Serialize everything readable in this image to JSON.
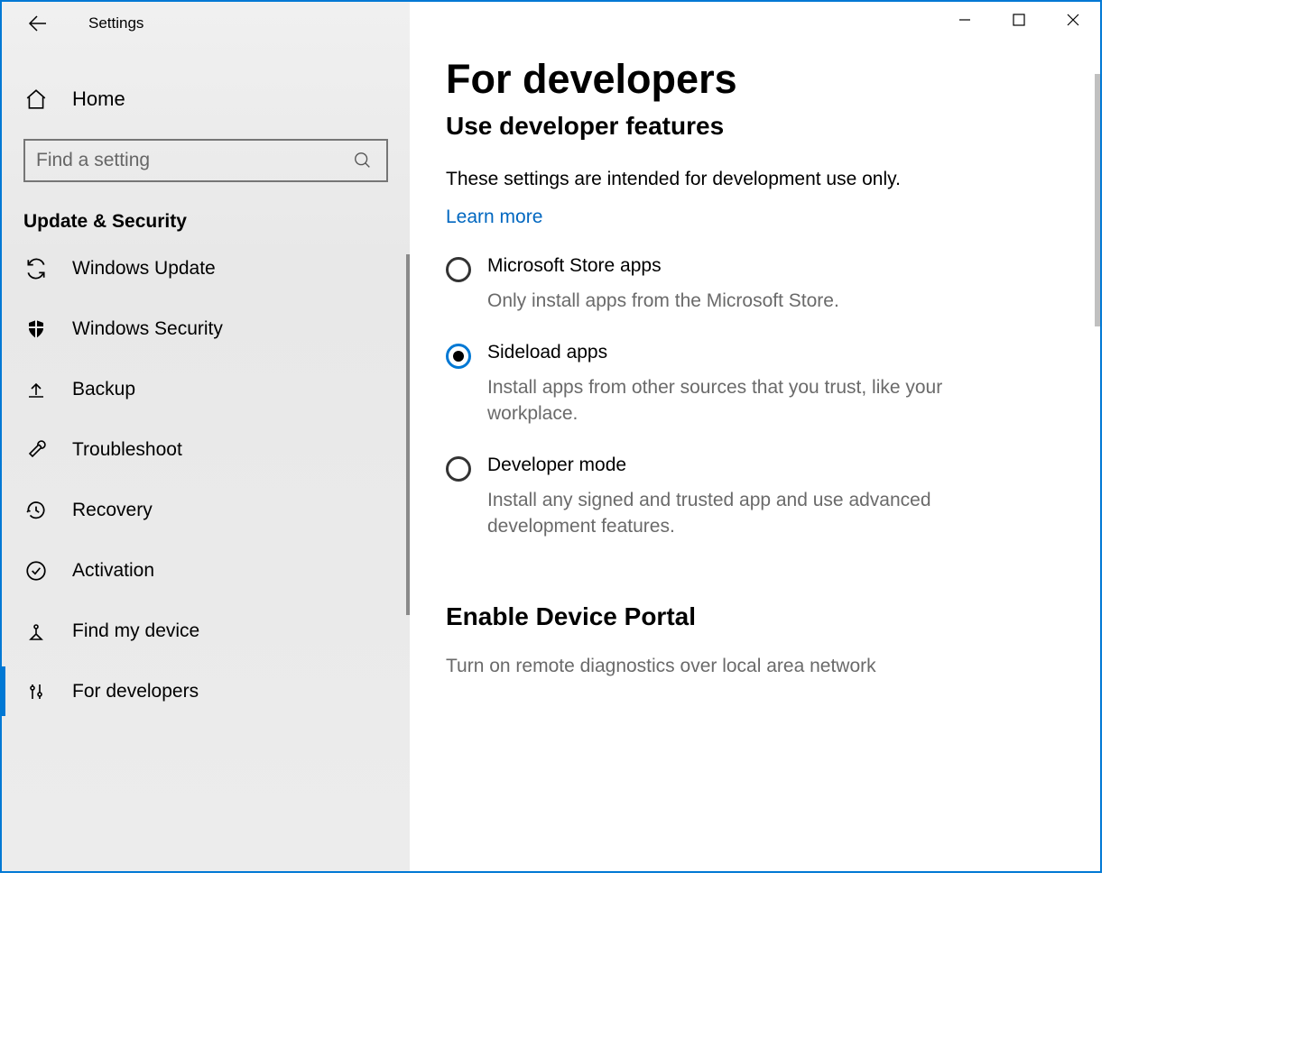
{
  "header": {
    "app_title": "Settings"
  },
  "sidebar": {
    "home_label": "Home",
    "search_placeholder": "Find a setting",
    "section_title": "Update & Security",
    "items": [
      {
        "label": "Windows Update",
        "icon": "sync-icon"
      },
      {
        "label": "Windows Security",
        "icon": "shield-icon"
      },
      {
        "label": "Backup",
        "icon": "backup-icon"
      },
      {
        "label": "Troubleshoot",
        "icon": "wrench-icon"
      },
      {
        "label": "Recovery",
        "icon": "history-icon"
      },
      {
        "label": "Activation",
        "icon": "check-circle-icon"
      },
      {
        "label": "Find my device",
        "icon": "location-icon"
      },
      {
        "label": "For developers",
        "icon": "dev-tools-icon",
        "active": true
      }
    ]
  },
  "main": {
    "page_title": "For developers",
    "subheader": "Use developer features",
    "intro": "These settings are intended for development use only.",
    "learn_more": "Learn more",
    "radios": [
      {
        "title": "Microsoft Store apps",
        "desc": "Only install apps from the Microsoft Store.",
        "selected": false
      },
      {
        "title": "Sideload apps",
        "desc": "Install apps from other sources that you trust, like your workplace.",
        "selected": true
      },
      {
        "title": "Developer mode",
        "desc": "Install any signed and trusted app and use advanced development features.",
        "selected": false
      }
    ],
    "section2_title": "Enable Device Portal",
    "section2_desc": "Turn on remote diagnostics over local area network"
  }
}
